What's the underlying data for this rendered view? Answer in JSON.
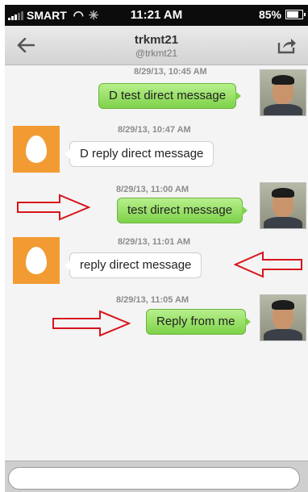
{
  "status_bar": {
    "carrier": "SMART",
    "time": "11:21 AM",
    "battery": "85%",
    "battery_level": 0.85
  },
  "header": {
    "title": "trkmt21",
    "subtitle": "@trkmt21",
    "back_icon": "arrow-left-icon",
    "share_icon": "share-icon"
  },
  "messages": [
    {
      "timestamp": "8/29/13, 10:45 AM",
      "text": "D test direct message",
      "direction": "sent"
    },
    {
      "timestamp": "8/29/13, 10:47 AM",
      "text": "D reply direct message",
      "direction": "received"
    },
    {
      "timestamp": "8/29/13, 11:00 AM",
      "text": "test direct message",
      "direction": "sent"
    },
    {
      "timestamp": "8/29/13, 11:01 AM",
      "text": "reply direct message",
      "direction": "received"
    },
    {
      "timestamp": "8/29/13, 11:05 AM",
      "text": "Reply from me",
      "direction": "sent"
    }
  ],
  "composer": {
    "placeholder": ""
  },
  "colors": {
    "sent_bubble": "#7ed24a",
    "received_bubble": "#ffffff",
    "egg_avatar": "#f29b32",
    "annotation_arrow": "#d8141b"
  }
}
